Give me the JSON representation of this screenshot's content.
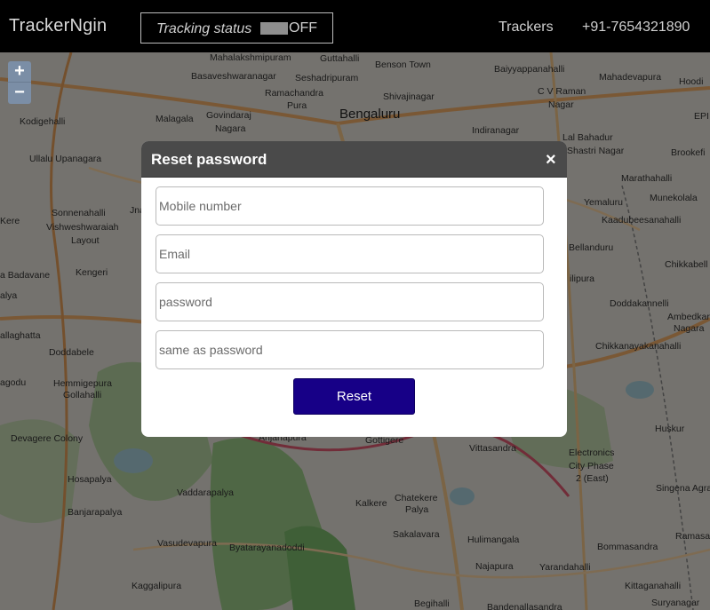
{
  "header": {
    "brand": "TrackerNgin",
    "tracking_label": "Tracking status",
    "tracking_state": "OFF",
    "nav_trackers": "Trackers",
    "nav_phone": "+91-7654321890"
  },
  "map": {
    "zoom_in": "+",
    "zoom_out": "−",
    "labels": [
      "Mahalakshmipuram",
      "Guttahalli",
      "Benson Town",
      "Baiyyappanahalli",
      "Mahadevapura",
      "Hoodi",
      "Basaveshwaranagar",
      "Seshadripuram",
      "Shivajinagar",
      "C V Raman",
      "Nagar",
      "Ramachandra",
      "Pura",
      "Bengaluru",
      "Kodigehalli",
      "Malagala",
      "Govindaraj",
      "Nagara",
      "Indiranagar",
      "EPI",
      "Lal Bahadur",
      "Ullalu Upanagara",
      "Shastri Nagar",
      "Brookefi",
      "Marathahalli",
      "Munekolala",
      "Sonnenahalli",
      "Vishweshwaraiah",
      "Layout",
      "Yemaluru",
      "Kaadubeesanahalli",
      "Kengeri",
      "Bellanduru",
      "Chikkabell",
      "a Badavane",
      "alya",
      "Doddakannelli",
      "Ambedkar",
      "allaghatta",
      "Doddabele",
      "Chikkanayakanahalli",
      "agodu",
      "Hemmigepura",
      "Gollahalli",
      "Devagere Colony",
      "Anjanapura",
      "Gottigere",
      "Vittasandra",
      "Huskur",
      "Electronics",
      "City Phase",
      "2 (East)",
      "Hosapalya",
      "Vaddarapalya",
      "Singena Agra",
      "Banjarapalya",
      "Chatekere",
      "Palya",
      "Kalkere",
      "Sakalavara",
      "Hulimangala",
      "Vasudevapura",
      "Byatarayanadoddi",
      "Bommasandra",
      "Ramasa",
      "Najapura",
      "Yarandahalli",
      "Kaggalipura",
      "Kittaganahalli",
      "Suryanagar",
      "Begihalli",
      "Bandenallasandra",
      "Jna",
      "ilipura",
      "Nagara",
      "Kere"
    ]
  },
  "modal": {
    "title": "Reset password",
    "close": "×",
    "fields": [
      {
        "placeholder": "Mobile number"
      },
      {
        "placeholder": "Email"
      },
      {
        "placeholder": "password"
      },
      {
        "placeholder": "same as password"
      }
    ],
    "submit": "Reset"
  },
  "colors": {
    "header_bg": "#000000",
    "modal_header_bg": "#4a4a4a",
    "button_bg": "#170087",
    "zoom_bg": "#7b8ea6"
  }
}
